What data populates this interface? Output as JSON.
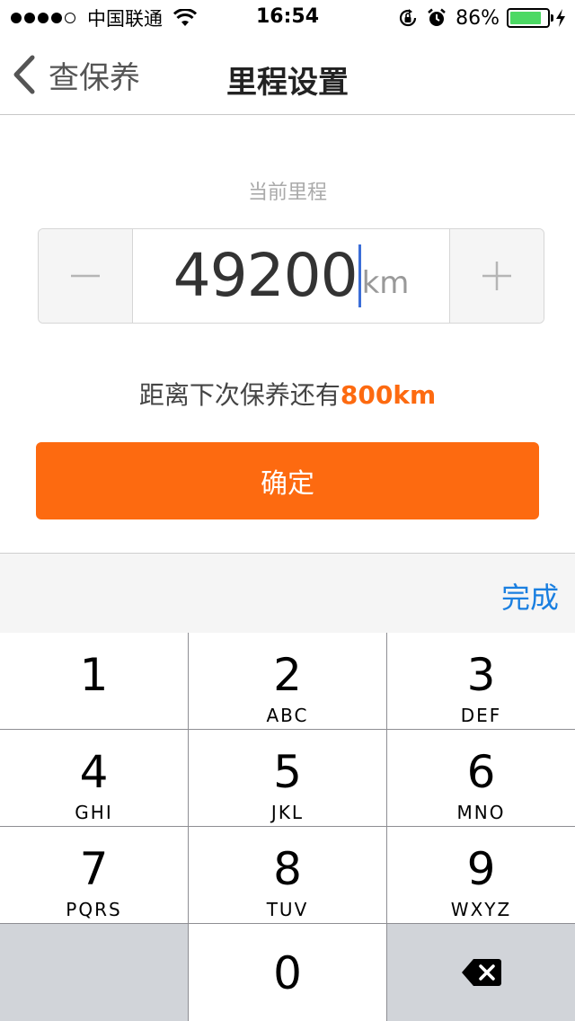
{
  "status_bar": {
    "carrier": "中国联通",
    "time": "16:54",
    "battery_percent": "86%",
    "battery_level": 0.86,
    "icons": [
      "signal-dots",
      "wifi-icon",
      "orientation-lock-icon",
      "alarm-icon",
      "battery-icon",
      "charging-bolt-icon"
    ]
  },
  "nav": {
    "back_label": "查保养",
    "title": "里程设置"
  },
  "mileage": {
    "label": "当前里程",
    "value": "49200",
    "unit": "km",
    "decrement_icon": "minus-icon",
    "increment_icon": "plus-icon"
  },
  "remaining": {
    "prefix": "距离下次保养还有",
    "value": "800km"
  },
  "confirm_label": "确定",
  "keyboard": {
    "done_label": "完成",
    "keys": [
      {
        "num": "1",
        "letters": ""
      },
      {
        "num": "2",
        "letters": "ABC"
      },
      {
        "num": "3",
        "letters": "DEF"
      },
      {
        "num": "4",
        "letters": "GHI"
      },
      {
        "num": "5",
        "letters": "JKL"
      },
      {
        "num": "6",
        "letters": "MNO"
      },
      {
        "num": "7",
        "letters": "PQRS"
      },
      {
        "num": "8",
        "letters": "TUV"
      },
      {
        "num": "9",
        "letters": "WXYZ"
      },
      {
        "num": "0",
        "letters": ""
      }
    ],
    "backspace_icon": "backspace-icon"
  },
  "colors": {
    "accent": "#fd6a10",
    "link": "#1a7fe0",
    "battery": "#4cd964"
  }
}
